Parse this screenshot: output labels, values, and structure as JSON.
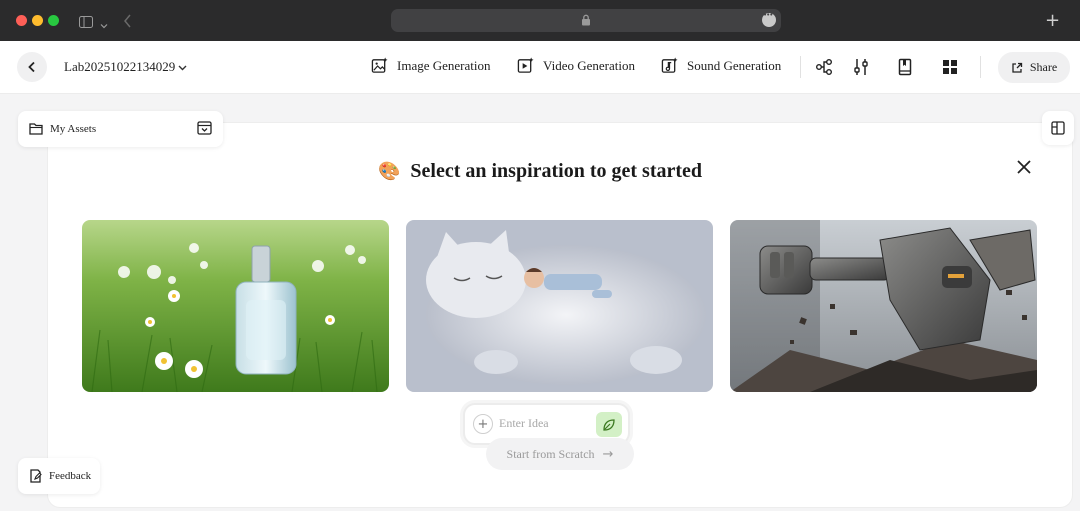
{
  "browser": {
    "traffic_lights": [
      "close",
      "minimize",
      "zoom"
    ],
    "new_tab_symbol": "+"
  },
  "topbar": {
    "project_name": "Lab20251022134029",
    "generators": [
      {
        "label": "Image Generation",
        "icon": "image-sparkle-icon"
      },
      {
        "label": "Video Generation",
        "icon": "video-sparkle-icon"
      },
      {
        "label": "Sound Generation",
        "icon": "sound-sparkle-icon"
      }
    ],
    "tools": [
      "nodes-icon",
      "sliders-icon",
      "book-icon",
      "grid-icon"
    ],
    "share_label": "Share"
  },
  "assets": {
    "label": "My Assets"
  },
  "inspiration": {
    "emoji": "🎨",
    "title": "Select an inspiration to get started",
    "cards": [
      {
        "name": "perfume-in-grass",
        "accent": "#5b9a2c"
      },
      {
        "name": "cat-and-baby",
        "accent": "#c6cbd6"
      },
      {
        "name": "mech-robot",
        "accent": "#6d6a66"
      }
    ]
  },
  "idea": {
    "placeholder": "Enter Idea",
    "scratch_label": "Start from Scratch",
    "scratch_arrow": "→"
  },
  "feedback": {
    "label": "Feedback"
  },
  "colors": {
    "chrome": "#2b2b2c",
    "send_button": "#d3f0c6",
    "background": "#f4f4f5"
  }
}
